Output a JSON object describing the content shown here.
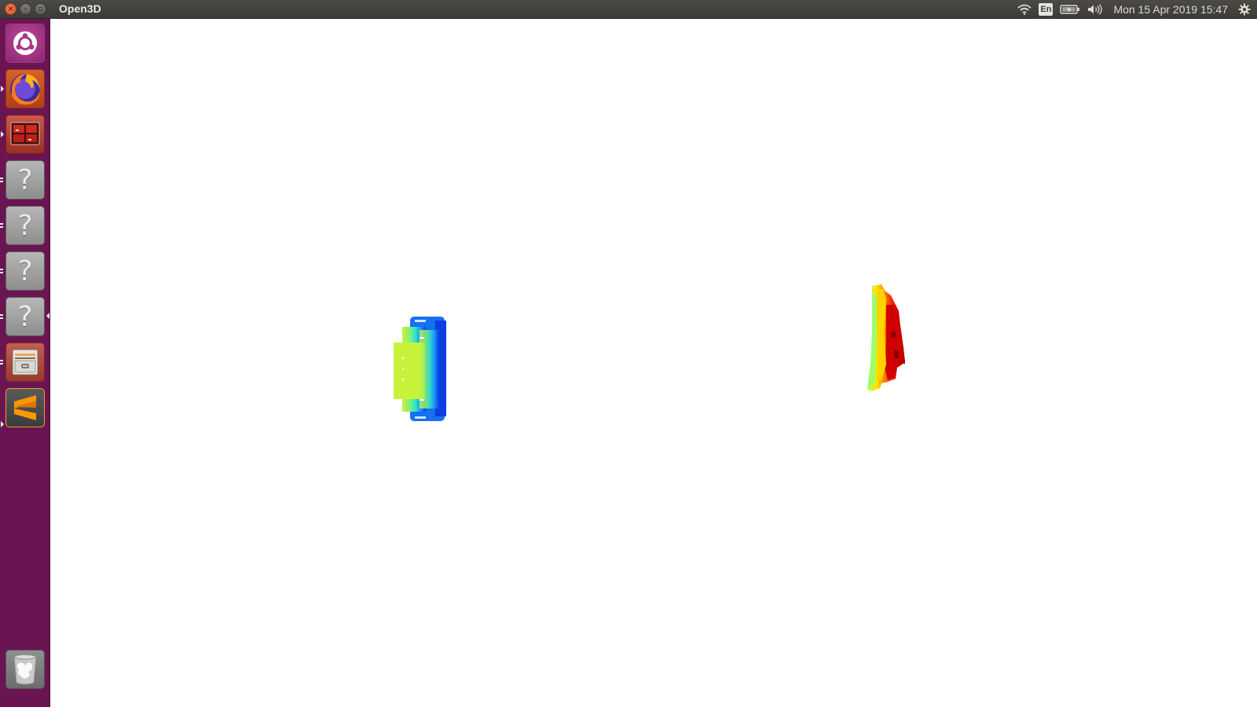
{
  "window": {
    "app_title": "Open3D"
  },
  "panel": {
    "keyboard_layout": "En",
    "clock": "Mon 15 Apr 2019 15:47",
    "icons": [
      "wifi-icon",
      "keyboard-layout-indicator",
      "battery-icon",
      "volume-icon",
      "system-gear-icon"
    ]
  },
  "launcher": {
    "items": [
      {
        "name": "dash-ubuntu",
        "icon": "ubuntu-logo-icon"
      },
      {
        "name": "firefox",
        "icon": "firefox-icon"
      },
      {
        "name": "system-monitor",
        "icon": "system-monitor-icon"
      },
      {
        "name": "unknown-app-1",
        "icon": "question-mark-icon",
        "glyph": "?"
      },
      {
        "name": "unknown-app-2",
        "icon": "question-mark-icon",
        "glyph": "?"
      },
      {
        "name": "unknown-app-3",
        "icon": "question-mark-icon",
        "glyph": "?"
      },
      {
        "name": "unknown-app-4",
        "icon": "question-mark-icon",
        "glyph": "?"
      },
      {
        "name": "file-cabinet",
        "icon": "file-cabinet-icon"
      },
      {
        "name": "sublime-text",
        "icon": "sublime-text-icon",
        "glyph": "S"
      },
      {
        "name": "trash",
        "icon": "trash-icon"
      }
    ]
  },
  "scene": {
    "description_colors": {
      "left_object": [
        "#c8f23a",
        "#2ee6c8",
        "#1a8cff",
        "#0b3fe0"
      ],
      "right_object": [
        "#b8ff5a",
        "#ffe400",
        "#ff6a00",
        "#e00000",
        "#b80000"
      ]
    }
  }
}
